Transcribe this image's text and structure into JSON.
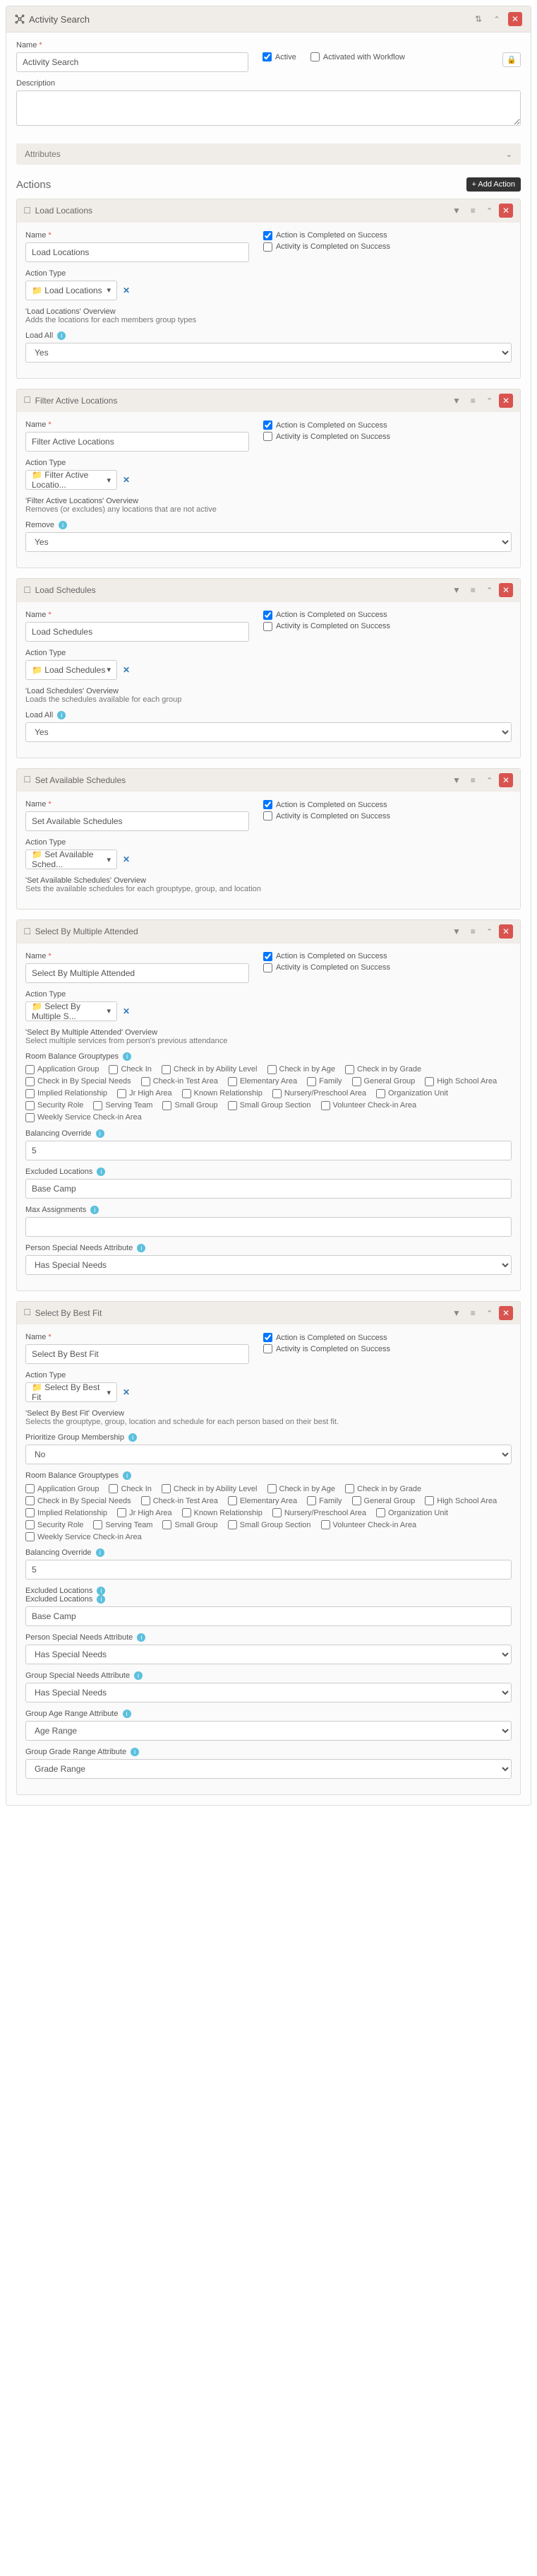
{
  "panel": {
    "title": "Activity Search"
  },
  "form": {
    "name_label": "Name",
    "name_value": "Activity Search",
    "description_label": "Description",
    "description_value": "",
    "active_label": "Active",
    "activated_workflow_label": "Activated with Workflow",
    "attributes_label": "Attributes"
  },
  "actions_section": {
    "title": "Actions",
    "add_button": "+ Add Action"
  },
  "common": {
    "name_label": "Name",
    "action_type_label": "Action Type",
    "completed_success_label": "Action is Completed on Success",
    "activity_completed_label": "Activity is Completed on Success",
    "folder_prefix": "📁",
    "yes": "Yes",
    "no": "No"
  },
  "actions": {
    "load_locations": {
      "header": "Load Locations",
      "name": "Load Locations",
      "action_type": "Load Locations",
      "overview_title": "'Load Locations' Overview",
      "overview_text": "Adds the locations for each members group types",
      "load_all_label": "Load All"
    },
    "filter_active": {
      "header": "Filter Active Locations",
      "name": "Filter Active Locations",
      "action_type": "Filter Active Locatio...",
      "overview_title": "'Filter Active Locations' Overview",
      "overview_text": "Removes (or excludes) any locations that are not active",
      "remove_label": "Remove"
    },
    "load_schedules": {
      "header": "Load Schedules",
      "name": "Load Schedules",
      "action_type": "Load Schedules",
      "overview_title": "'Load Schedules' Overview",
      "overview_text": "Loads the schedules available for each group",
      "load_all_label": "Load All"
    },
    "set_available": {
      "header": "Set Available Schedules",
      "name": "Set Available Schedules",
      "action_type": "Set Available Sched...",
      "overview_title": "'Set Available Schedules' Overview",
      "overview_text": "Sets the available schedules for each grouptype, group, and location"
    },
    "select_multiple": {
      "header": "Select By Multiple Attended",
      "name": "Select By Multiple Attended",
      "action_type": "Select By Multiple S...",
      "overview_title": "'Select By Multiple Attended' Overview",
      "overview_text": "Select multiple services from person's previous attendance",
      "room_balance_label": "Room Balance Grouptypes",
      "balancing_override_label": "Balancing Override",
      "balancing_override_value": "5",
      "excluded_locations_label": "Excluded Locations",
      "excluded_locations_value": "Base Camp",
      "max_assignments_label": "Max Assignments",
      "max_assignments_value": "",
      "person_special_label": "Person Special Needs Attribute",
      "person_special_value": "Has Special Needs"
    },
    "select_best_fit": {
      "header": "Select By Best Fit",
      "name": "Select By Best Fit",
      "action_type": "Select By Best Fit",
      "overview_title": "'Select By Best Fit' Overview",
      "overview_text": "Selects the grouptype, group, location and schedule for each person based on their best fit.",
      "prioritize_label": "Prioritize Group Membership",
      "room_balance_label": "Room Balance Grouptypes",
      "balancing_override_label": "Balancing Override",
      "balancing_override_value": "5",
      "excluded_locations_label": "Excluded Locations",
      "excluded_locations_label2": "Excluded Locations",
      "excluded_locations_value": "Base Camp",
      "person_special_label": "Person Special Needs Attribute",
      "person_special_value": "Has Special Needs",
      "group_special_label": "Group Special Needs Attribute",
      "group_special_value": "Has Special Needs",
      "group_age_label": "Group Age Range Attribute",
      "group_age_value": "Age Range",
      "group_grade_label": "Group Grade Range Attribute",
      "group_grade_value": "Grade Range"
    }
  },
  "room_balance_options": [
    "Application Group",
    "Check In",
    "Check in by Ability Level",
    "Check in by Age",
    "Check in by Grade",
    "Check in By Special Needs",
    "Check-in Test Area",
    "Elementary Area",
    "Family",
    "General Group",
    "High School Area",
    "Implied Relationship",
    "Jr High Area",
    "Known Relationship",
    "Nursery/Preschool Area",
    "Organization Unit",
    "Security Role",
    "Serving Team",
    "Small Group",
    "Small Group Section",
    "Volunteer Check-in Area",
    "Weekly Service Check-in Area"
  ]
}
